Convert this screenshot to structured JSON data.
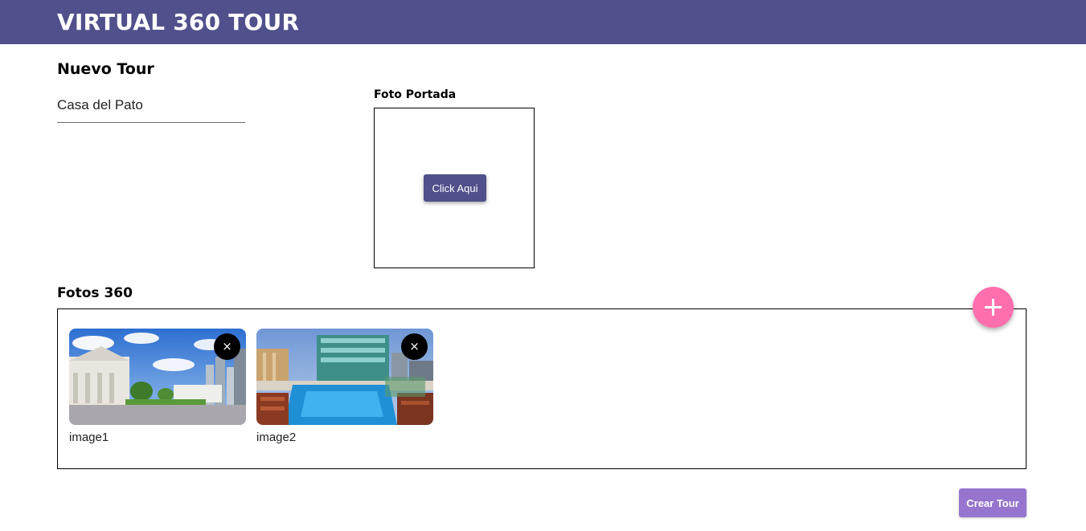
{
  "app": {
    "title": "VIRTUAL 360 TOUR"
  },
  "form": {
    "heading": "Nuevo Tour",
    "tour_name_value": "Casa del Pato"
  },
  "cover": {
    "label": "Foto Portada",
    "button_label": "Click Aqui"
  },
  "photos": {
    "heading": "Fotos 360",
    "items": [
      {
        "caption": "image1",
        "remove_label": "×"
      },
      {
        "caption": "image2",
        "remove_label": "×"
      }
    ],
    "add_icon": "plus-icon"
  },
  "actions": {
    "create_label": "Crear Tour"
  },
  "colors": {
    "primary": "#50508c",
    "accent_fab": "#ff6fae",
    "create_button": "#9575cd"
  }
}
